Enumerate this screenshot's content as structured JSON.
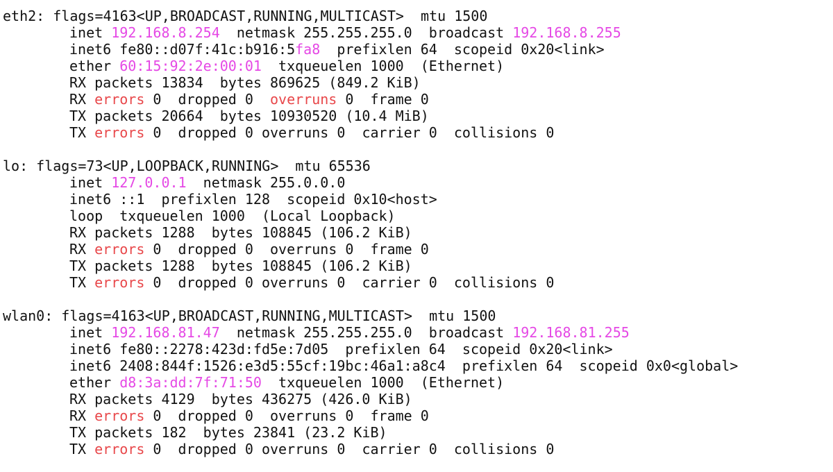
{
  "terminal": {
    "sections": [
      {
        "lines": [
          [
            {
              "t": "eth2: flags=4163<UP,BROADCAST,RUNNING,MULTICAST>  mtu 1500"
            }
          ],
          [
            {
              "t": "inet "
            },
            {
              "t": "192.168.8.254",
              "c": "magenta"
            },
            {
              "t": "  netmask 255.255.255.0  broadcast "
            },
            {
              "t": "192.168.8.255",
              "c": "magenta"
            }
          ],
          [
            {
              "t": "inet6 fe80::d07f:41c:b916:5"
            },
            {
              "t": "fa8",
              "c": "magenta"
            },
            {
              "t": "  prefixlen 64  scopeid 0x20<link>"
            }
          ],
          [
            {
              "t": "ether "
            },
            {
              "t": "60:15:92:2e:00:01",
              "c": "magenta"
            },
            {
              "t": "  txqueuelen 1000  (Ethernet)"
            }
          ],
          [
            {
              "t": "RX packets 13834  bytes 869625 (849.2 KiB)"
            }
          ],
          [
            {
              "t": "RX "
            },
            {
              "t": "errors",
              "c": "red"
            },
            {
              "t": " 0  dropped 0  "
            },
            {
              "t": "overruns",
              "c": "red"
            },
            {
              "t": " 0  frame 0"
            }
          ],
          [
            {
              "t": "TX packets 20664  bytes 10930520 (10.4 MiB)"
            }
          ],
          [
            {
              "t": "TX "
            },
            {
              "t": "errors",
              "c": "red"
            },
            {
              "t": " 0  dropped 0 overruns 0  carrier 0  collisions 0"
            }
          ]
        ]
      },
      {
        "lines": [
          [
            {
              "t": "lo: flags=73<UP,LOOPBACK,RUNNING>  mtu 65536"
            }
          ],
          [
            {
              "t": "inet "
            },
            {
              "t": "127.0.0.1",
              "c": "magenta"
            },
            {
              "t": "  netmask 255.0.0.0"
            }
          ],
          [
            {
              "t": "inet6 ::1  prefixlen 128  scopeid 0x10<host>"
            }
          ],
          [
            {
              "t": "loop  txqueuelen 1000  (Local Loopback)"
            }
          ],
          [
            {
              "t": "RX packets 1288  bytes 108845 (106.2 KiB)"
            }
          ],
          [
            {
              "t": "RX "
            },
            {
              "t": "errors",
              "c": "red"
            },
            {
              "t": " 0  dropped 0  overruns 0  frame 0"
            }
          ],
          [
            {
              "t": "TX packets 1288  bytes 108845 (106.2 KiB)"
            }
          ],
          [
            {
              "t": "TX "
            },
            {
              "t": "errors",
              "c": "red"
            },
            {
              "t": " 0  dropped 0 overruns 0  carrier 0  collisions 0"
            }
          ]
        ]
      },
      {
        "lines": [
          [
            {
              "t": "wlan0: flags=4163<UP,BROADCAST,RUNNING,MULTICAST>  mtu 1500"
            }
          ],
          [
            {
              "t": "inet "
            },
            {
              "t": "192.168.81.47",
              "c": "magenta"
            },
            {
              "t": "  netmask 255.255.255.0  broadcast "
            },
            {
              "t": "192.168.81.255",
              "c": "magenta"
            }
          ],
          [
            {
              "t": "inet6 fe80::2278:423d:fd5e:7d05  prefixlen 64  scopeid 0x20<link>"
            }
          ],
          [
            {
              "t": "inet6 2408:844f:1526:e3d5:55cf:19bc:46a1:a8c4  prefixlen 64  scopeid 0x0<global>"
            }
          ],
          [
            {
              "t": "ether "
            },
            {
              "t": "d8:3a:dd:7f:71:50",
              "c": "magenta"
            },
            {
              "t": "  txqueuelen 1000  (Ethernet)"
            }
          ],
          [
            {
              "t": "RX packets 4129  bytes 436275 (426.0 KiB)"
            }
          ],
          [
            {
              "t": "RX "
            },
            {
              "t": "errors",
              "c": "red"
            },
            {
              "t": " 0  dropped 0  overruns 0  frame 0"
            }
          ],
          [
            {
              "t": "TX packets 182  bytes 23841 (23.2 KiB)"
            }
          ],
          [
            {
              "t": "TX "
            },
            {
              "t": "errors",
              "c": "red"
            },
            {
              "t": " 0  dropped 0 overruns 0  carrier 0  collisions 0"
            }
          ]
        ]
      }
    ]
  },
  "colors": {
    "background": "#ffffff",
    "text": "#111111",
    "magenta": "#e548e5",
    "red": "#e8474a"
  }
}
